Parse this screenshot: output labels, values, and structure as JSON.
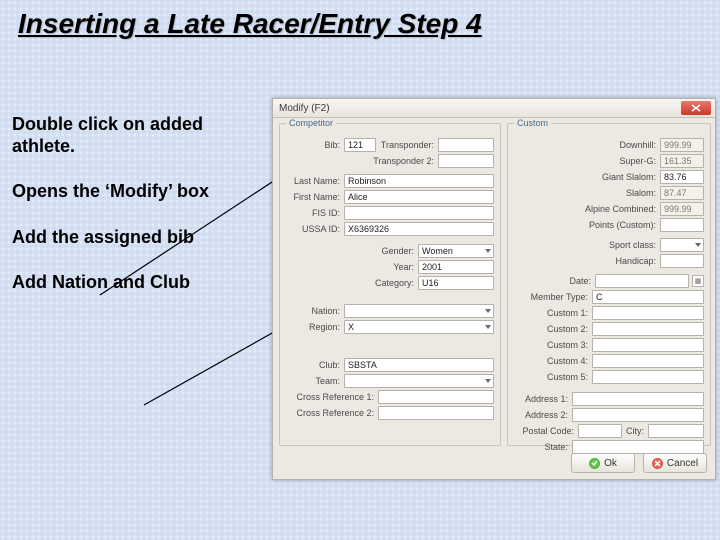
{
  "slide": {
    "title": "Inserting a Late Racer/Entry Step 4",
    "instructions": [
      "Double click on added athlete.",
      "Opens the ‘Modify’ box",
      "Add the assigned bib",
      "Add Nation and Club"
    ]
  },
  "dialog": {
    "title": "Modify (F2)",
    "close_icon": "close-icon",
    "groups": {
      "competitor": "Competitor",
      "custom": "Custom"
    },
    "competitor": {
      "bib": {
        "label": "Bib:",
        "value": "121"
      },
      "transponder": {
        "label": "Transponder:",
        "value": ""
      },
      "transponder2": {
        "label": "Transponder 2:",
        "value": ""
      },
      "last_name": {
        "label": "Last Name:",
        "value": "Robinson"
      },
      "first_name": {
        "label": "First Name:",
        "value": "Alice"
      },
      "fis_id": {
        "label": "FIS ID:",
        "value": ""
      },
      "ussa_id": {
        "label": "USSA ID:",
        "value": "X6369326"
      },
      "gender": {
        "label": "Gender:",
        "value": "Women"
      },
      "year": {
        "label": "Year:",
        "value": "2001"
      },
      "category": {
        "label": "Category:",
        "value": "U16"
      },
      "nation": {
        "label": "Nation:",
        "value": ""
      },
      "region": {
        "label": "Region:",
        "value": "X"
      },
      "club": {
        "label": "Club:",
        "value": "SBSTA"
      },
      "team": {
        "label": "Team:",
        "value": ""
      },
      "cross_ref1": {
        "label": "Cross Reference 1:",
        "value": ""
      },
      "cross_ref2": {
        "label": "Cross Reference 2:",
        "value": ""
      }
    },
    "custom": {
      "downhill": {
        "label": "Downhill:",
        "value": "999.99"
      },
      "superg": {
        "label": "Super-G:",
        "value": "161.35"
      },
      "giant_slalom": {
        "label": "Giant Slalom:",
        "value": "83.76"
      },
      "slalom": {
        "label": "Slalom:",
        "value": "87.47"
      },
      "alpine_combined": {
        "label": "Alpine Combined:",
        "value": "999.99"
      },
      "points_custom": {
        "label": "Points (Custom):",
        "value": ""
      },
      "sport_class": {
        "label": "Sport class:",
        "value": ""
      },
      "handicap": {
        "label": "Handicap:",
        "value": ""
      },
      "date": {
        "label": "Date:",
        "value": ""
      },
      "member_type": {
        "label": "Member Type:",
        "value": "C"
      },
      "custom1": {
        "label": "Custom 1:",
        "value": ""
      },
      "custom2": {
        "label": "Custom 2:",
        "value": ""
      },
      "custom3": {
        "label": "Custom 3:",
        "value": ""
      },
      "custom4": {
        "label": "Custom 4:",
        "value": ""
      },
      "custom5": {
        "label": "Custom 5:",
        "value": ""
      },
      "address1": {
        "label": "Address 1:",
        "value": ""
      },
      "address2": {
        "label": "Address 2:",
        "value": ""
      },
      "postal_code": {
        "label": "Postal Code:",
        "value": ""
      },
      "city": {
        "label": "City:",
        "value": ""
      },
      "state": {
        "label": "State:",
        "value": ""
      }
    },
    "buttons": {
      "ok": "Ok",
      "cancel": "Cancel"
    }
  }
}
